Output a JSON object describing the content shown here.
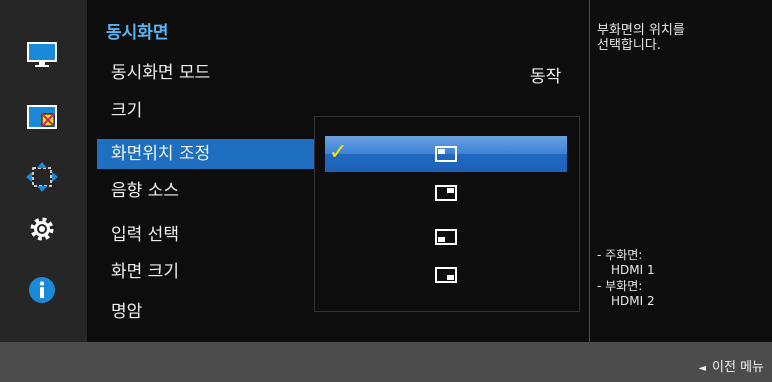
{
  "menu": {
    "title": "동시화면",
    "items": [
      {
        "label": "동시화면 모드",
        "value": "동작"
      },
      {
        "label": "크기"
      },
      {
        "label": "화면위치 조정",
        "selected": true
      },
      {
        "label": "음향 소스"
      },
      {
        "label": "입력 선택"
      },
      {
        "label": "화면 크기"
      },
      {
        "label": "명암"
      }
    ]
  },
  "side_icons": [
    "monitor-icon",
    "picture-in-picture-icon",
    "move-arrows-icon",
    "gear-icon",
    "info-icon"
  ],
  "position_options": [
    {
      "icon": "pip-top-left-icon",
      "selected": true
    },
    {
      "icon": "pip-top-right-icon",
      "selected": false
    },
    {
      "icon": "pip-bottom-left-icon",
      "selected": false
    },
    {
      "icon": "pip-bottom-right-icon",
      "selected": false
    }
  ],
  "help": {
    "description": "부화면의 위치를\n선택합니다.",
    "main_label": "주화면:",
    "main_source": "HDMI 1",
    "sub_label": "부화면:",
    "sub_source": "HDMI 2"
  },
  "footer": {
    "back_label": "이전 메뉴",
    "back_icon": "triangle-left-icon"
  },
  "colors": {
    "accent": "#1e6fc0",
    "title": "#5ab3f0",
    "check": "#f6e900",
    "panel": "#0d0d0d",
    "strip": "#262626",
    "frame": "#4c4c4c"
  }
}
